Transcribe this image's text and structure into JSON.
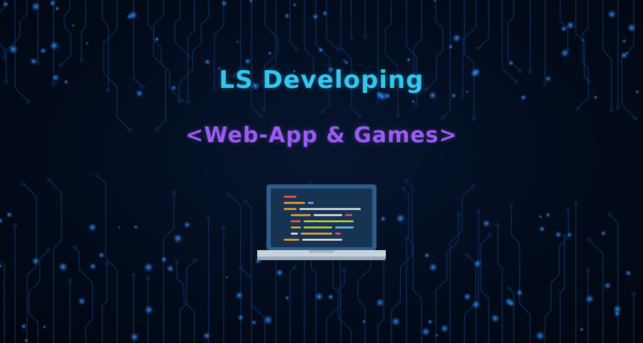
{
  "banner": {
    "title": "LS Developing",
    "subtitle": "<Web-App & Games>",
    "laptop_icon": "laptop-code-icon",
    "background": "circuit-board-pattern"
  },
  "colors": {
    "background": "#020a18",
    "title": "#35c6f0",
    "subtitle": "#9a5cf2",
    "circuit_trace": "#0d2a55",
    "circuit_glow": "#2f8fff",
    "laptop_frame": "#2f5c8a",
    "laptop_screen": "#163352",
    "laptop_base": "#c7d3de"
  },
  "code_colors": [
    "#e85a4f",
    "#f2a531",
    "#6fb6e8",
    "#e8e8e8",
    "#b4d13a"
  ]
}
